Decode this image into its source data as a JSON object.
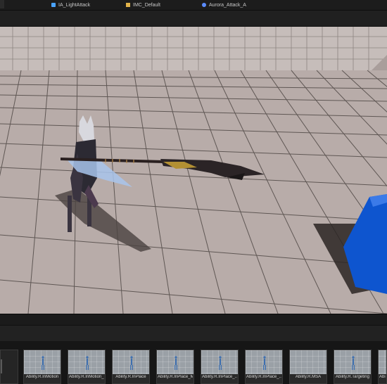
{
  "tabs": [
    {
      "label": "IA_LightAttack",
      "icon": "input-action-icon",
      "color": "#4aa3ff"
    },
    {
      "label": "IMC_Default",
      "icon": "mapping-context-icon",
      "color": "#e2b34a"
    },
    {
      "label": "Aurora_Attack_A",
      "icon": "anim-montage-icon",
      "color": "#5b8cff"
    }
  ],
  "viewport": {
    "floor_color": "#b8aca9",
    "wall_color": "#c4bab7",
    "grid_color": "#6e6562",
    "cube_color": "#0d52c9"
  },
  "content_browser": {
    "assets": [
      {
        "label": "Ability.R.InMotion"
      },
      {
        "label": "Ability.R.InMotion_..."
      },
      {
        "label": "Ability.R.InPlace"
      },
      {
        "label": "Ability.R.InPlace_MSA"
      },
      {
        "label": "Ability.R.InPlace_..."
      },
      {
        "label": "Ability.R.InPlace_..._MSA"
      },
      {
        "label": "Ability.R.MSA"
      },
      {
        "label": "Ability.R.Targeting"
      },
      {
        "label": "Abil"
      }
    ]
  }
}
